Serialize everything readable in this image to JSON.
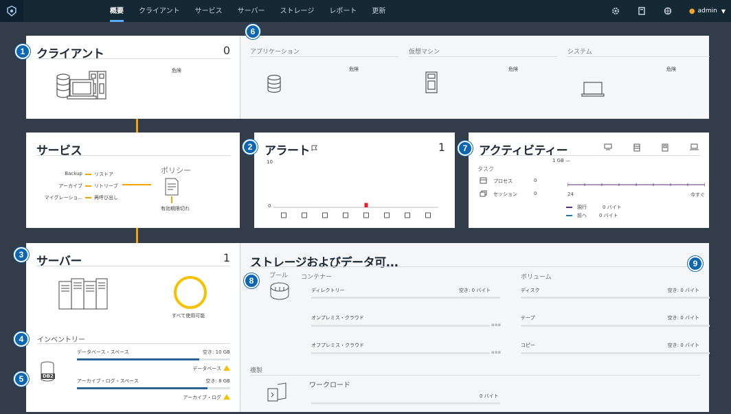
{
  "nav": {
    "items": [
      "概要",
      "クライアント",
      "サービス",
      "サーバー",
      "ストレージ",
      "レポート",
      "更新"
    ],
    "active": 0,
    "user": "admin"
  },
  "badges": [
    "1",
    "2",
    "3",
    "4",
    "5",
    "6",
    "7",
    "8",
    "9"
  ],
  "clients": {
    "title": "クライアント",
    "count": "0",
    "status": "危険"
  },
  "apps": [
    {
      "title": "アプリケーション",
      "status": "危険"
    },
    {
      "title": "仮想マシン",
      "status": "危険"
    },
    {
      "title": "システム",
      "status": "危険"
    }
  ],
  "services": {
    "title": "サービス",
    "rows": [
      {
        "left": "Backup",
        "right": "リストア"
      },
      {
        "left": "アーカイブ",
        "right": "リトリーブ"
      },
      {
        "left": "マイグレーショ...",
        "right": "再呼び出し"
      }
    ],
    "policy_title": "ポリシー",
    "policy_status": "有効期限切れ"
  },
  "alerts": {
    "title": "アラート",
    "count": "1",
    "y_max": "10",
    "y_min": "0",
    "values": [
      0,
      0,
      0,
      0,
      1,
      0,
      0,
      0
    ],
    "icons": [
      "client-icon",
      "db-icon",
      "server-icon",
      "laptop-icon",
      "tower-icon",
      "drive-icon",
      "globe-icon",
      "storage-icon"
    ]
  },
  "activity": {
    "title": "アクティビティー",
    "task_label": "タスク",
    "process_label": "プロセス",
    "process_count": "0",
    "session_label": "セッション",
    "session_count": "0",
    "scale_top": "1 GB —",
    "axis_start": "24",
    "axis_end": "今すぐ",
    "legend_current": "現行",
    "legend_current_value": "0 バイト",
    "legend_prev": "前へ",
    "legend_prev_value": "0 バイト",
    "colors": {
      "current": "#5a2d82",
      "prev": "#2a6fb0"
    }
  },
  "servers": {
    "title": "サーバー",
    "count": "1",
    "ring_label": "すべて使用可能",
    "ring_color": "#f4c200"
  },
  "inventory": {
    "title": "インベントリー",
    "db_label": "DB2",
    "db_space_label": "データベース・スペース",
    "db_space_free": "空き: 10 GB",
    "db_space_used": 0.8,
    "db_warn_label": "データベース",
    "log_space_label": "アーカイブ・ログ・スペース",
    "log_space_free": "空き: 8 GB",
    "log_space_used": 0.85,
    "log_warn_label": "アーカイブ・ログ"
  },
  "storage": {
    "title": "ストレージおよびデータ可...",
    "pool_label": "プール",
    "container_label": "コンテナー",
    "volume_label": "ボリューム",
    "containers": [
      {
        "name": "ディレクトリー",
        "free": "空き: 0 バイト"
      },
      {
        "name": "オンプレミス・クラウド",
        "free": ""
      },
      {
        "name": "オフプレミス・クラウド",
        "free": ""
      }
    ],
    "volumes": [
      {
        "name": "ディスク",
        "free": "空き: 0 バイト"
      },
      {
        "name": "テープ",
        "free": "空き: 0 バイト"
      },
      {
        "name": "コピー",
        "free": "空き: 0 バイト"
      }
    ],
    "replication_label": "複製",
    "workload_label": "ワークロード",
    "workload_value": "0 バイト"
  }
}
